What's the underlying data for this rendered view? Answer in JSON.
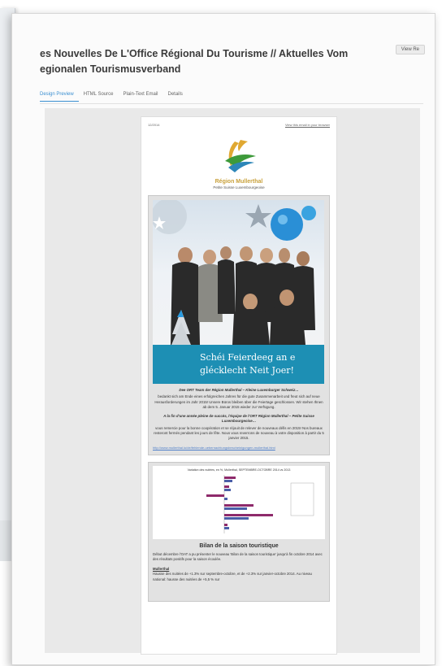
{
  "page_title": "es Nouvelles De L'Office Régional Du Tourisme // Aktuelles Vom egionalen Tourismusverband",
  "view_button": "View Re",
  "tabs": [
    {
      "label": "Design Preview",
      "active": true
    },
    {
      "label": "HTML Source",
      "active": false
    },
    {
      "label": "Plain-Text Email",
      "active": false
    },
    {
      "label": "Details",
      "active": false
    }
  ],
  "email": {
    "date": "12/2014",
    "view_online": "View this email in your browser",
    "logo_name": "Région Mullerthal",
    "logo_sub": "Petite Suisse Luxembourgeoise",
    "banner_text": "Schéi Feierdeeg an e glécklecht Neit Joer!",
    "para1_bold": "Dee ORT Team der Région Mullerthal – Kleine Luxemburger Schweiz…",
    "para1": "bedankt sich am Ende eines erfolgreichen Jahres für die gute Zusammenarbeit und freut sich auf neue Herausforderungen im Jahr 2015! Unsere Büros bleiben über die Feiertage geschlossen. Wir stehen Ihnen ab dem 5. Januar 2015 wieder zur Verfügung.",
    "para2_bold": "A la fin d'une année pleine de succès, l'équipe de l'ORT Région Mullerthal – Petite Suisse Luxembourgeoise…",
    "para2": "vous remercie pour la bonne coopération et se réjouit de relever de nouveaux défis en 2015! Nos bureaux resteront fermés pendant les jours de fête. Nous vous reverrons de nouveau à votre disposition à partir du 5 janvier 2015.",
    "link": "http://www.mullerthal.lu/de/fehlende-uebernachtungsbescheinigungen-mullerthal.html",
    "chart_title": "Variation des nuitées, en %, Mullerthal, SEPTEMBRE-OCTOBRE 2014 vs 2013",
    "bilan_title": "Bilan de la saison touristique",
    "bilan_text": "Début décembre l'OAT a pu présenter le nouveau 'Bilan de la saison touristique' jusqu'à fin octobre 2014 avec des résultats positifs pour la saison écoulée.",
    "bilan_sub": "Mullerthal",
    "bilan_text2": "Hausse des nuitées de +1.3% sur septembre-octobre, et de +2.3% sur janvier-octobre 2014. Au niveau national: hausse des nuitées de +5,5 % sur"
  }
}
